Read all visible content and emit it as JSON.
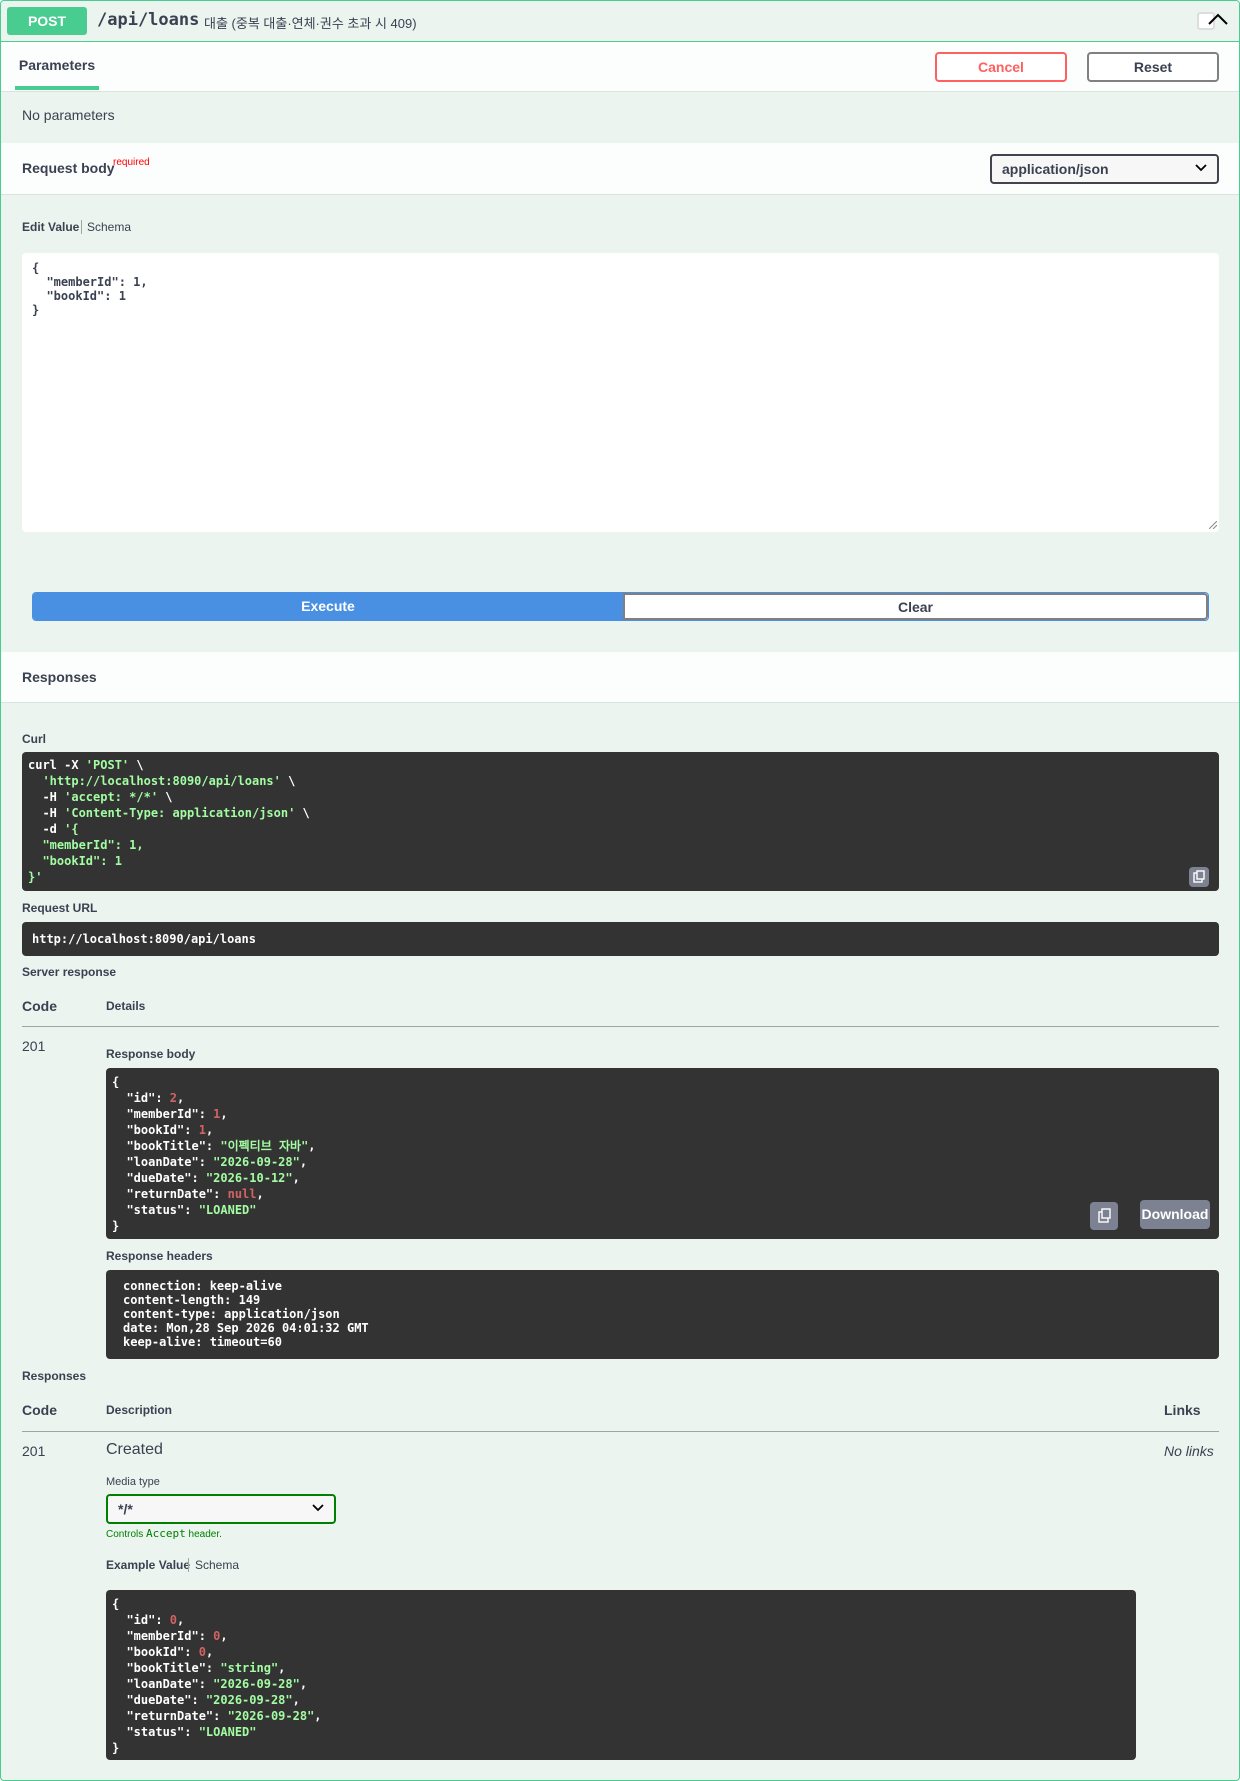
{
  "summary": {
    "method": "POST",
    "path": "/api/loans",
    "description": "대출 (중복 대출·연체·권수 초과 시 409)"
  },
  "parameters": {
    "tab_label": "Parameters",
    "cancel_label": "Cancel",
    "reset_label": "Reset",
    "empty_text": "No parameters"
  },
  "request_body": {
    "title": "Request body",
    "required_label": "required",
    "content_type": "application/json",
    "edit_value_tab": "Edit Value",
    "schema_tab": "Schema",
    "value": "{\n  \"memberId\": 1,\n  \"bookId\": 1\n}"
  },
  "actions": {
    "execute_label": "Execute",
    "clear_label": "Clear"
  },
  "responses_section": {
    "title": "Responses",
    "curl_label": "Curl",
    "curl_lines": [
      {
        "plain": "curl -X ",
        "str": "'POST'",
        "tail": " \\"
      },
      {
        "plain": "  ",
        "str": "'http://localhost:8090/api/loans'",
        "tail": " \\"
      },
      {
        "plain": "  -H ",
        "str": "'accept: */*'",
        "tail": " \\"
      },
      {
        "plain": "  -H ",
        "str": "'Content-Type: application/json'",
        "tail": " \\"
      },
      {
        "plain": "  -d ",
        "str": "'{",
        "tail": ""
      },
      {
        "plain": "",
        "str": "  \"memberId\": 1,",
        "tail": ""
      },
      {
        "plain": "",
        "str": "  \"bookId\": 1",
        "tail": ""
      },
      {
        "plain": "",
        "str": "}'",
        "tail": ""
      }
    ],
    "request_url_label": "Request URL",
    "request_url": "http://localhost:8090/api/loans",
    "server_response_label": "Server response",
    "code_header": "Code",
    "details_header": "Details",
    "status_code": "201",
    "response_body_label": "Response body",
    "response_body": [
      {
        "key": "\"id\"",
        "val": "2",
        "type": "n",
        "comma": ","
      },
      {
        "key": "\"memberId\"",
        "val": "1",
        "type": "n",
        "comma": ","
      },
      {
        "key": "\"bookId\"",
        "val": "1",
        "type": "n",
        "comma": ","
      },
      {
        "key": "\"bookTitle\"",
        "val": "\"이펙티브 자바\"",
        "type": "s",
        "comma": ","
      },
      {
        "key": "\"loanDate\"",
        "val": "\"2026-09-28\"",
        "type": "s",
        "comma": ","
      },
      {
        "key": "\"dueDate\"",
        "val": "\"2026-10-12\"",
        "type": "s",
        "comma": ","
      },
      {
        "key": "\"returnDate\"",
        "val": "null",
        "type": "n",
        "comma": ","
      },
      {
        "key": "\"status\"",
        "val": "\"LOANED\"",
        "type": "s",
        "comma": ""
      }
    ],
    "download_label": "Download",
    "response_headers_label": "Response headers",
    "response_headers": [
      "connection: keep-alive",
      "content-length: 149",
      "content-type: application/json",
      "date: Mon,28 Sep 2026 04:01:32 GMT",
      "keep-alive: timeout=60"
    ]
  },
  "documented_responses": {
    "title": "Responses",
    "code_header": "Code",
    "description_header": "Description",
    "links_header": "Links",
    "status_code": "201",
    "description": "Created",
    "links_value": "No links",
    "media_type_label": "Media type",
    "media_type": "*/*",
    "accept_note_prefix": "Controls ",
    "accept_note_code": "Accept",
    "accept_note_suffix": " header.",
    "example_value_tab": "Example Value",
    "schema_tab": "Schema",
    "example": [
      {
        "key": "\"id\"",
        "val": "0",
        "type": "n",
        "comma": ","
      },
      {
        "key": "\"memberId\"",
        "val": "0",
        "type": "n",
        "comma": ","
      },
      {
        "key": "\"bookId\"",
        "val": "0",
        "type": "n",
        "comma": ","
      },
      {
        "key": "\"bookTitle\"",
        "val": "\"string\"",
        "type": "s",
        "comma": ","
      },
      {
        "key": "\"loanDate\"",
        "val": "\"2026-09-28\"",
        "type": "s",
        "comma": ","
      },
      {
        "key": "\"dueDate\"",
        "val": "\"2026-09-28\"",
        "type": "s",
        "comma": ","
      },
      {
        "key": "\"returnDate\"",
        "val": "\"2026-09-28\"",
        "type": "s",
        "comma": ","
      },
      {
        "key": "\"status\"",
        "val": "\"LOANED\"",
        "type": "s",
        "comma": ""
      }
    ]
  },
  "colors": {
    "post_accent": "#49cc90",
    "execute_blue": "#4990e2",
    "cancel_red": "#ff6060",
    "code_bg": "#333333",
    "string_green": "#a2fca2",
    "number_red": "#d36363"
  }
}
